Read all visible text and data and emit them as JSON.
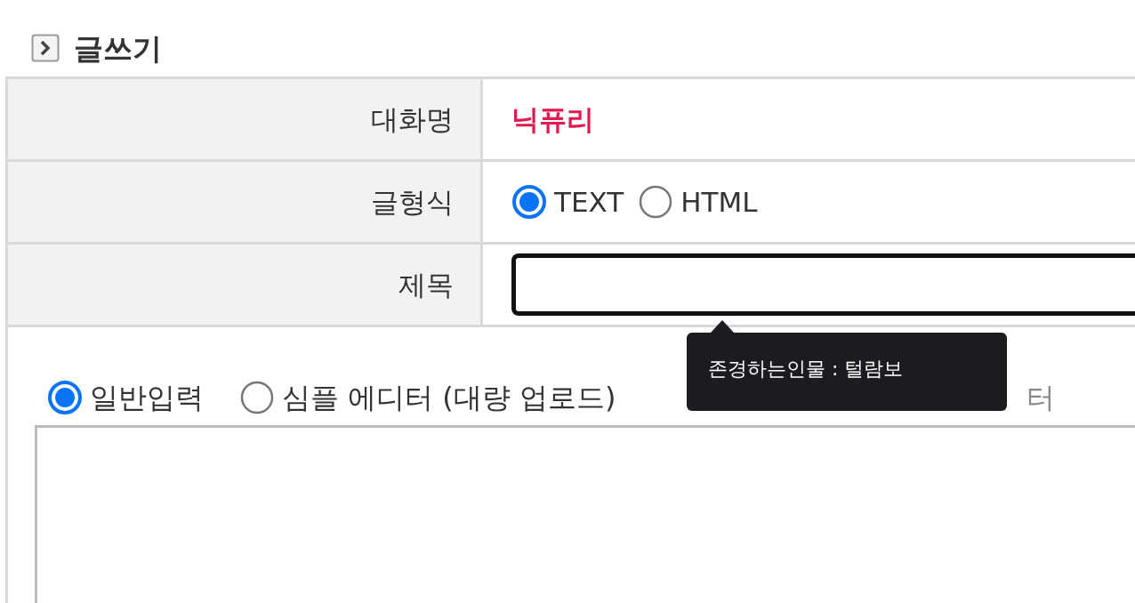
{
  "heading": "글쓰기",
  "rows": [
    {
      "kind": "name",
      "label": "대화명",
      "value": "닉퓨리"
    },
    {
      "kind": "radios",
      "label": "글형식",
      "options": [
        {
          "label": "TEXT",
          "selected": true
        },
        {
          "label": "HTML",
          "selected": false
        }
      ]
    },
    {
      "kind": "input",
      "label": "제목",
      "value": ""
    }
  ],
  "tooltip": "존경하는인물 : 털람보",
  "editor_modes": [
    {
      "label": "일반입력",
      "selected": true,
      "kind": "radio"
    },
    {
      "label": "심플 에디터 (대량 업로드)",
      "selected": false,
      "kind": "radio"
    },
    {
      "label": "터",
      "kind": "partial"
    }
  ]
}
